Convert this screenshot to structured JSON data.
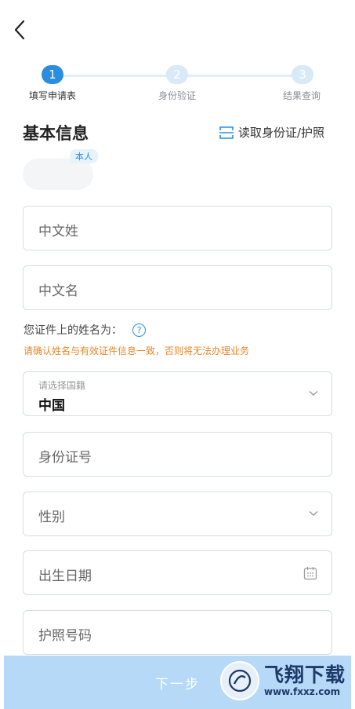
{
  "steps": [
    {
      "num": "1",
      "label": "填写申请表"
    },
    {
      "num": "2",
      "label": "身份验证"
    },
    {
      "num": "3",
      "label": "结果查询"
    }
  ],
  "section": {
    "title": "基本信息",
    "read_id_label": "读取身份证/护照",
    "self_tag": "本人"
  },
  "form": {
    "surname_placeholder": "中文姓",
    "given_name_placeholder": "中文名",
    "name_hint": "您证件上的姓名为：",
    "help_symbol": "?",
    "warning": "请确认姓名与有效证件信息一致，否则将无法办理业务",
    "nationality_label": "请选择国籍",
    "nationality_value": "中国",
    "id_number_placeholder": "身份证号",
    "gender_placeholder": "性别",
    "birth_date_placeholder": "出生日期",
    "passport_placeholder": "护照号码"
  },
  "footer": {
    "next_label": "下一步"
  },
  "watermark": {
    "title": "飞翔下载",
    "url": "www.fxxz.com"
  },
  "colors": {
    "accent": "#2a8de0",
    "step_inactive": "#d8e9f8",
    "warning": "#e8872b",
    "button_bg": "#b5d9f7"
  }
}
